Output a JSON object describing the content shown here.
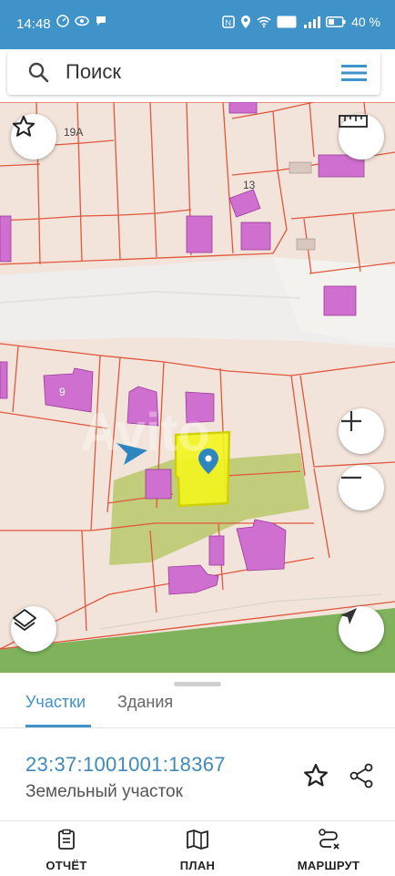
{
  "status_bar": {
    "time": "14:48",
    "battery": "40 %",
    "icons": [
      "nfc-icon",
      "location-icon",
      "wifi-icon",
      "vowifi-icon",
      "signal-4g-icon",
      "battery-icon"
    ]
  },
  "search": {
    "placeholder": "Поиск"
  },
  "map": {
    "labels": {
      "house_19a": "19А",
      "house_13": "13",
      "house_9": "9"
    },
    "watermark": "Avito",
    "colors": {
      "parcel_fill": "#f2e4da",
      "parcel_border": "#e0573d",
      "building": "#cf6fcf",
      "selected": "#f3f51c",
      "road": "#efeeec",
      "grass": "#7fb25b"
    }
  },
  "tabs": {
    "parcels": "Участки",
    "buildings": "Здания",
    "active": "parcels"
  },
  "parcel": {
    "number": "23:37:1001001:18367",
    "type": "Земельный участок"
  },
  "nav": {
    "report": "ОТЧЁТ",
    "plan": "ПЛАН",
    "route": "МАРШРУТ"
  }
}
